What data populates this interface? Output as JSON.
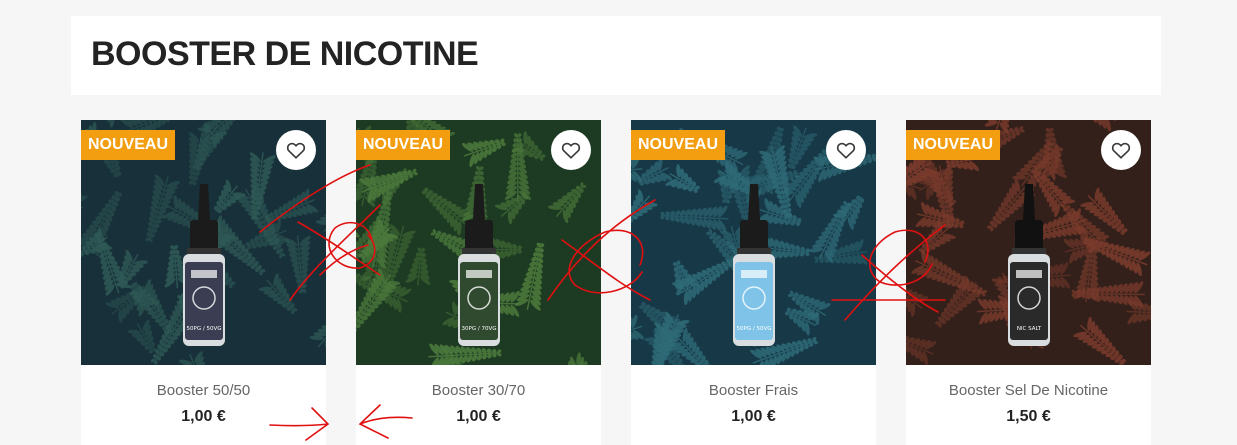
{
  "header": {
    "title": "BOOSTER DE NICOTINE"
  },
  "products": [
    {
      "name": "Booster 50/50",
      "price": "1,00 €",
      "badge": "NOUVEAU",
      "label_text": "50PG / 50VG",
      "bg_dark": "#17303a",
      "leaf": "#2f5a56",
      "label_color": "#3b3e52",
      "cap": "#1b1b1b"
    },
    {
      "name": "Booster 30/70",
      "price": "1,00 €",
      "badge": "NOUVEAU",
      "label_text": "30PG / 70VG",
      "bg_dark": "#1d3a22",
      "leaf": "#4c7a3c",
      "label_color": "#2f4a2f",
      "cap": "#1b1b1b"
    },
    {
      "name": "Booster Frais",
      "price": "1,00 €",
      "badge": "NOUVEAU",
      "label_text": "50PG / 50VG",
      "bg_dark": "#173846",
      "leaf": "#2f6b78",
      "label_color": "#7fc4e8",
      "cap": "#1b1b1b"
    },
    {
      "name": "Booster Sel De Nicotine",
      "price": "1,50 €",
      "badge": "NOUVEAU",
      "label_text": "NIC SALT",
      "bg_dark": "#33201a",
      "leaf": "#7a3b2c",
      "label_color": "#2a2a2a",
      "cap": "#111111"
    }
  ],
  "wishlist_icon": "heart-icon",
  "colors": {
    "badge": "#f39d10",
    "annotation": "#e01010"
  }
}
